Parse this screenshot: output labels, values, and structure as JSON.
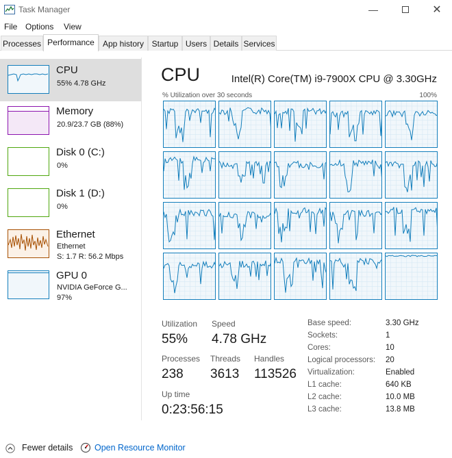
{
  "window": {
    "title": "Task Manager",
    "minimize_icon": "minimize-icon",
    "maximize_icon": "maximize-icon",
    "close_icon": "close-icon"
  },
  "menu": [
    "File",
    "Options",
    "View"
  ],
  "tabs": [
    {
      "label": "Processes",
      "active": false
    },
    {
      "label": "Performance",
      "active": true
    },
    {
      "label": "App history",
      "active": false
    },
    {
      "label": "Startup",
      "active": false
    },
    {
      "label": "Users",
      "active": false
    },
    {
      "label": "Details",
      "active": false
    },
    {
      "label": "Services",
      "active": false
    }
  ],
  "sidebar": {
    "items": [
      {
        "title": "CPU",
        "line1": "55%  4.78 GHz",
        "line2": "",
        "color": "#117dbb"
      },
      {
        "title": "Memory",
        "line1": "20.9/23.7 GB (88%)",
        "line2": "",
        "color": "#8b12ae"
      },
      {
        "title": "Disk 0 (C:)",
        "line1": "0%",
        "line2": "",
        "color": "#4da60c"
      },
      {
        "title": "Disk 1 (D:)",
        "line1": "0%",
        "line2": "",
        "color": "#4da60c"
      },
      {
        "title": "Ethernet",
        "line1": "Ethernet",
        "line2": "S: 1.7  R: 56.2 Mbps",
        "color": "#a74f01"
      },
      {
        "title": "GPU 0",
        "line1": "NVIDIA GeForce G...",
        "line2": "97%",
        "color": "#117dbb"
      }
    ]
  },
  "main": {
    "heading": "CPU",
    "model": "Intel(R) Core(TM) i9-7900X CPU @ 3.30GHz",
    "graph_label": "% Utilization over 30 seconds",
    "graph_max": "100%",
    "stats": {
      "utilization_label": "Utilization",
      "utilization_value": "55%",
      "speed_label": "Speed",
      "speed_value": "4.78 GHz",
      "processes_label": "Processes",
      "processes_value": "238",
      "threads_label": "Threads",
      "threads_value": "3613",
      "handles_label": "Handles",
      "handles_value": "113526",
      "uptime_label": "Up time",
      "uptime_value": "0:23:56:15"
    },
    "specs": [
      {
        "label": "Base speed:",
        "value": "3.30 GHz"
      },
      {
        "label": "Sockets:",
        "value": "1"
      },
      {
        "label": "Cores:",
        "value": "10"
      },
      {
        "label": "Logical processors:",
        "value": "20"
      },
      {
        "label": "Virtualization:",
        "value": "Enabled"
      },
      {
        "label": "L1 cache:",
        "value": "640 KB"
      },
      {
        "label": "L2 cache:",
        "value": "10.0 MB"
      },
      {
        "label": "L3 cache:",
        "value": "13.8 MB"
      }
    ]
  },
  "footer": {
    "fewer_details": "Fewer details",
    "resource_monitor": "Open Resource Monitor",
    "link_color": "#0066cc"
  },
  "colors": {
    "accent": "#117dbb",
    "selected": "#cce8ff"
  }
}
